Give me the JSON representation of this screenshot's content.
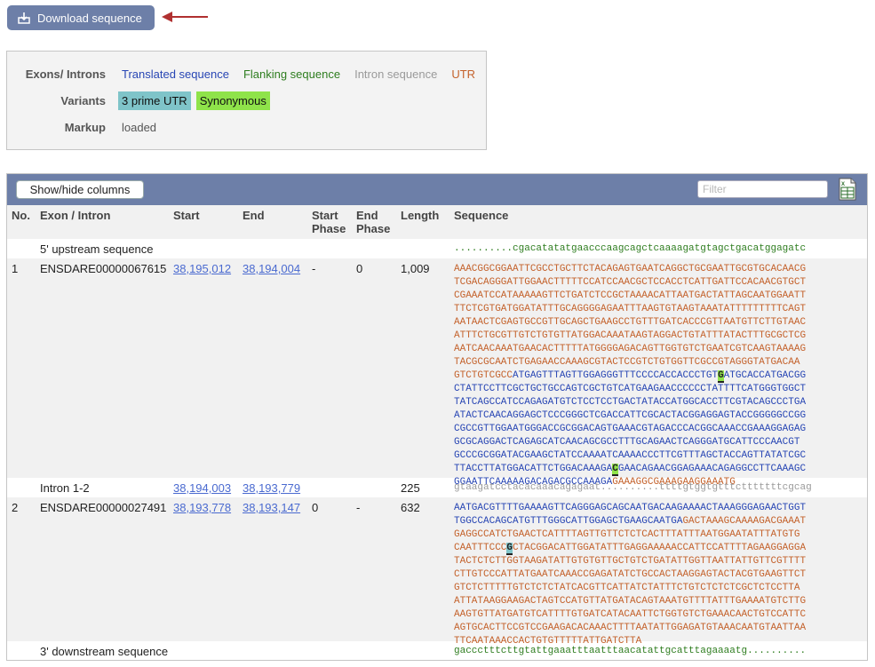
{
  "download": {
    "label": "Download sequence"
  },
  "legend": {
    "exons_label": "Exons/ Introns",
    "exon_types": [
      {
        "label": "Translated sequence",
        "color": "#2846b4"
      },
      {
        "label": "Flanking sequence",
        "color": "#2e7d1f"
      },
      {
        "label": "Intron sequence",
        "color": "#9a9a9a"
      },
      {
        "label": "UTR",
        "color": "#c4622c"
      }
    ],
    "variants_label": "Variants",
    "variants": [
      {
        "label": "3 prime UTR",
        "color": "#7fc4c9"
      },
      {
        "label": "Synonymous",
        "color": "#8fe34a"
      }
    ],
    "markup_label": "Markup",
    "markup_value": "loaded"
  },
  "table": {
    "show_hide_label": "Show/hide columns",
    "filter_placeholder": "Filter",
    "columns": {
      "no": "No.",
      "exon": "Exon / Intron",
      "start": "Start",
      "end": "End",
      "start_phase_1": "Start",
      "start_phase_2": "Phase",
      "end_phase_1": "End",
      "end_phase_2": "Phase",
      "length": "Length",
      "sequence": "Sequence"
    },
    "rows": [
      {
        "no": "",
        "name": "5' upstream sequence",
        "start": "",
        "end": "",
        "start_phase": "",
        "end_phase": "",
        "length": "",
        "seq": [
          [
            [
              "dots",
              ".........."
            ],
            [
              "flank",
              "cgacatatatgaacccaagcagctcaaaagatgtagctgacatggagatc"
            ]
          ]
        ]
      },
      {
        "no": "1",
        "name": "ENSDARE00000067615",
        "start": "38,195,012",
        "end": "38,194,004",
        "start_phase": "-",
        "end_phase": "0",
        "length": "1,009",
        "seq": [
          [
            [
              "utr",
              "AAACGGCGGAATTCGCCTGCTTCTACAGAGTGAATCAGGCTGCGAATTGCGTGCACAACG"
            ]
          ],
          [
            [
              "utr",
              "TCGACAGGGATTGGAACTTTTTCCATCCAACGCTCCACCTCATTGATTCCACAACGTGCT"
            ]
          ],
          [
            [
              "utr",
              "CGAAATCCATAAAAAGTTCTGATCTCCGCTAAAACATTAATGACTATTAGCAATGGAATT"
            ]
          ],
          [
            [
              "utr",
              "TTCTCGTGATGGATATTTGCAGGGGAGAATTTAAGTGTAAGTAAATATTTTTTTTTCAGT"
            ]
          ],
          [
            [
              "utr",
              "AATAACTCGAGTGCCGTTGCAGCTGAAGCCTGTTTGATCACCCGTTAATGTTCTTGTAAC"
            ]
          ],
          [
            [
              "utr",
              "ATTTCTGCGTTGTCTGTGTTATGGACAAATAAGTAGGACTGTATTTATACTTTGCGCTCG"
            ]
          ],
          [
            [
              "utr",
              "AATCAACAAATGAACACTTTTTATGGGGAGACAGTTGGTGTCTGAATCGTCAAGTAAAAG"
            ]
          ],
          [
            [
              "utr",
              "TACGCGCAATCTGAGAACCAAAGCGTACTCCGTCTGTGGTTCGCCGTAGGGTATGACAA"
            ]
          ],
          [
            [
              "utr",
              "GTCTGTCGCC"
            ],
            [
              "trans",
              "ATGAGTTTAGTTGGAGGGTTTCCCCACCACCCTGT"
            ],
            [
              "syn",
              "G"
            ],
            [
              "trans",
              "ATGCACCATGACGG"
            ]
          ],
          [
            [
              "trans",
              "CTATTCCTTCGCTGCTGCCAGTCGCTGTCATGAAGAACCCCCCTATTTTCATGGGTGGCT"
            ]
          ],
          [
            [
              "trans",
              "TATCAGCCATCCAGAGATGTCTCCTCCTGACTATACCATGGCACCTTCGTACAGCCCTGA"
            ]
          ],
          [
            [
              "trans",
              "ATACTCAACAGGAGCTCCCGGGCTCGACCATTCGCACTACGGAGGAGTACCGGGGGCCGG"
            ]
          ],
          [
            [
              "trans",
              "CGCCGTTGGAATGGGACCGCGGACAGTGAAACGTAGACCCACGGCAAACCGAAAGGAGAG"
            ]
          ],
          [
            [
              "trans",
              "GCGCAGGACTCAGAGCATCAACAGCGCCTTTGCAGAACTCAGGGATGCATTCCCAACGT"
            ]
          ],
          [
            [
              "trans",
              "GCCCGCGGATACGAAGCTATCCAAAATCAAAACCCTTCGTTTAGCTACCAGTTATATCGC"
            ]
          ],
          [
            [
              "trans",
              "TTACCTTATGGACATTCTGGACAAAGA"
            ],
            [
              "syn",
              "C"
            ],
            [
              "trans",
              "GAACAGAACGGAGAAACAGAGGCCTTCAAAGC"
            ]
          ],
          [
            [
              "trans",
              "GGAATTCAAAAAGACAGACGCCAAAGA"
            ],
            [
              "utr",
              "GAAAGGCGAAAGAAGGAAATG"
            ]
          ]
        ]
      },
      {
        "no": "",
        "name": "Intron 1-2",
        "start": "38,194,003",
        "end": "38,193,779",
        "start_phase": "",
        "end_phase": "",
        "length": "225",
        "seq": [
          [
            [
              "intron",
              "gtaagatcctacacaaacagagaat..........ttttgtggtgtttctttttttcgcag"
            ]
          ]
        ]
      },
      {
        "no": "2",
        "name": "ENSDARE00000027491",
        "start": "38,193,778",
        "end": "38,193,147",
        "start_phase": "0",
        "end_phase": "-",
        "length": "632",
        "seq": [
          [
            [
              "trans",
              "AATGACGTTTTGAAAAGTTCAGGGAGCAGCAATGACAAGAAAACTAAAGGGAGAACTGGT"
            ]
          ],
          [
            [
              "trans",
              "TGGCCACAGCATGTTTGGGCATTGGAGCTGAAGCAATGA"
            ],
            [
              "utr",
              "GACTAAAGCAAAAGACGAAAT"
            ]
          ],
          [
            [
              "utr",
              "GAGGCCATCTGAACTCATTTTAGTTGTTCTCTCACTTTATTTAATGGAATATTTATGTG"
            ]
          ],
          [
            [
              "utr",
              "CAATTTCCC"
            ],
            [
              "utrv",
              "G"
            ],
            [
              "utr",
              "CTACGGACATTGGATATTTGAGGAAAAACCATTCCATTTTAGAAGGAGGA"
            ]
          ],
          [
            [
              "utr",
              "TACTCTCTTGGTAAGATATTGTGTGTTGCTGTCTGATATTGGTTAATTATTGTTCGTTTT"
            ]
          ],
          [
            [
              "utr",
              "CTTGTCCCATTATGAATCAAACCGAGATATCTGCCACTAAGGAGTACTACGTGAAGTTCT"
            ]
          ],
          [
            [
              "utr",
              "GTCTCTTTTTGTCTCTCTATCACGTTCATTATCTATTTCTGTCTCTCTCGCTCTCCTTA"
            ]
          ],
          [
            [
              "utr",
              "ATTATAAGGAAGACTAGTCCATGTTATGATACAGTAAATGTTTTATTTGAAAATGTCTTG"
            ]
          ],
          [
            [
              "utr",
              "AAGTGTTATGATGTCATTTTGTGATCATACAATTCTGGTGTCTGAAACAACTGTCCATTC"
            ]
          ],
          [
            [
              "utr",
              "AGTGCACTTCCGTCCGAAGACACAAACTTTTAATATTGGAGATGTAAACAATGTAATTAA"
            ]
          ],
          [
            [
              "utr",
              "TTCAATAAACCACTGTGTTTTTATTGATCTTA"
            ]
          ]
        ]
      },
      {
        "no": "",
        "name": "3' downstream sequence",
        "start": "",
        "end": "",
        "start_phase": "",
        "end_phase": "",
        "length": "",
        "seq": [
          [
            [
              "flank",
              "gaccctttcttgtattgaaatttaatttaacatattgcatttagaaaatg"
            ],
            [
              "dots",
              ".........."
            ]
          ]
        ]
      }
    ]
  }
}
